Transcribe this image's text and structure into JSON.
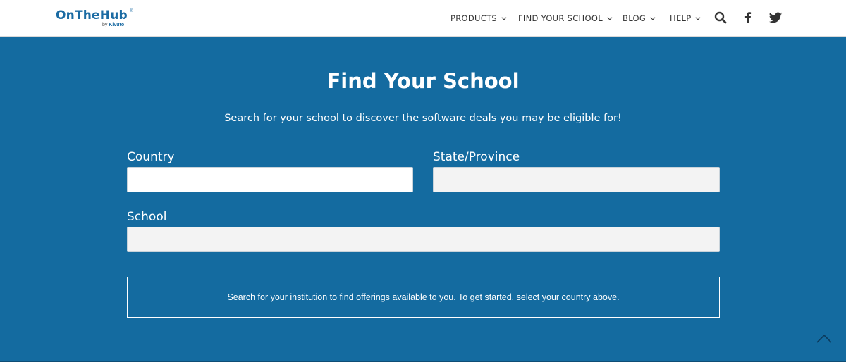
{
  "header": {
    "logo": {
      "name": "OnTheHub",
      "reg": "®",
      "by": "by",
      "brand": "Kivuto"
    },
    "nav": [
      {
        "label": "PRODUCTS"
      },
      {
        "label": "FIND YOUR SCHOOL"
      },
      {
        "label": "BLOG"
      },
      {
        "label": "HELP"
      }
    ],
    "icons": [
      "search-icon",
      "facebook-icon",
      "twitter-icon"
    ]
  },
  "main": {
    "title": "Find Your School",
    "subtitle": "Search for your school to discover the software deals you may be eligible for!",
    "country_label": "Country",
    "country_value": "",
    "state_label": "State/Province",
    "state_value": "",
    "school_label": "School",
    "school_value": "",
    "info_text": "Search for your institution to find offerings available to you. To get started, select your country above."
  },
  "colors": {
    "background": "#146ba0",
    "header_bg": "#ffffff",
    "brand": "#1b6ba3",
    "disabled_field": "#f3f3f3"
  },
  "scroll_top_icon": "chevron-up-icon"
}
